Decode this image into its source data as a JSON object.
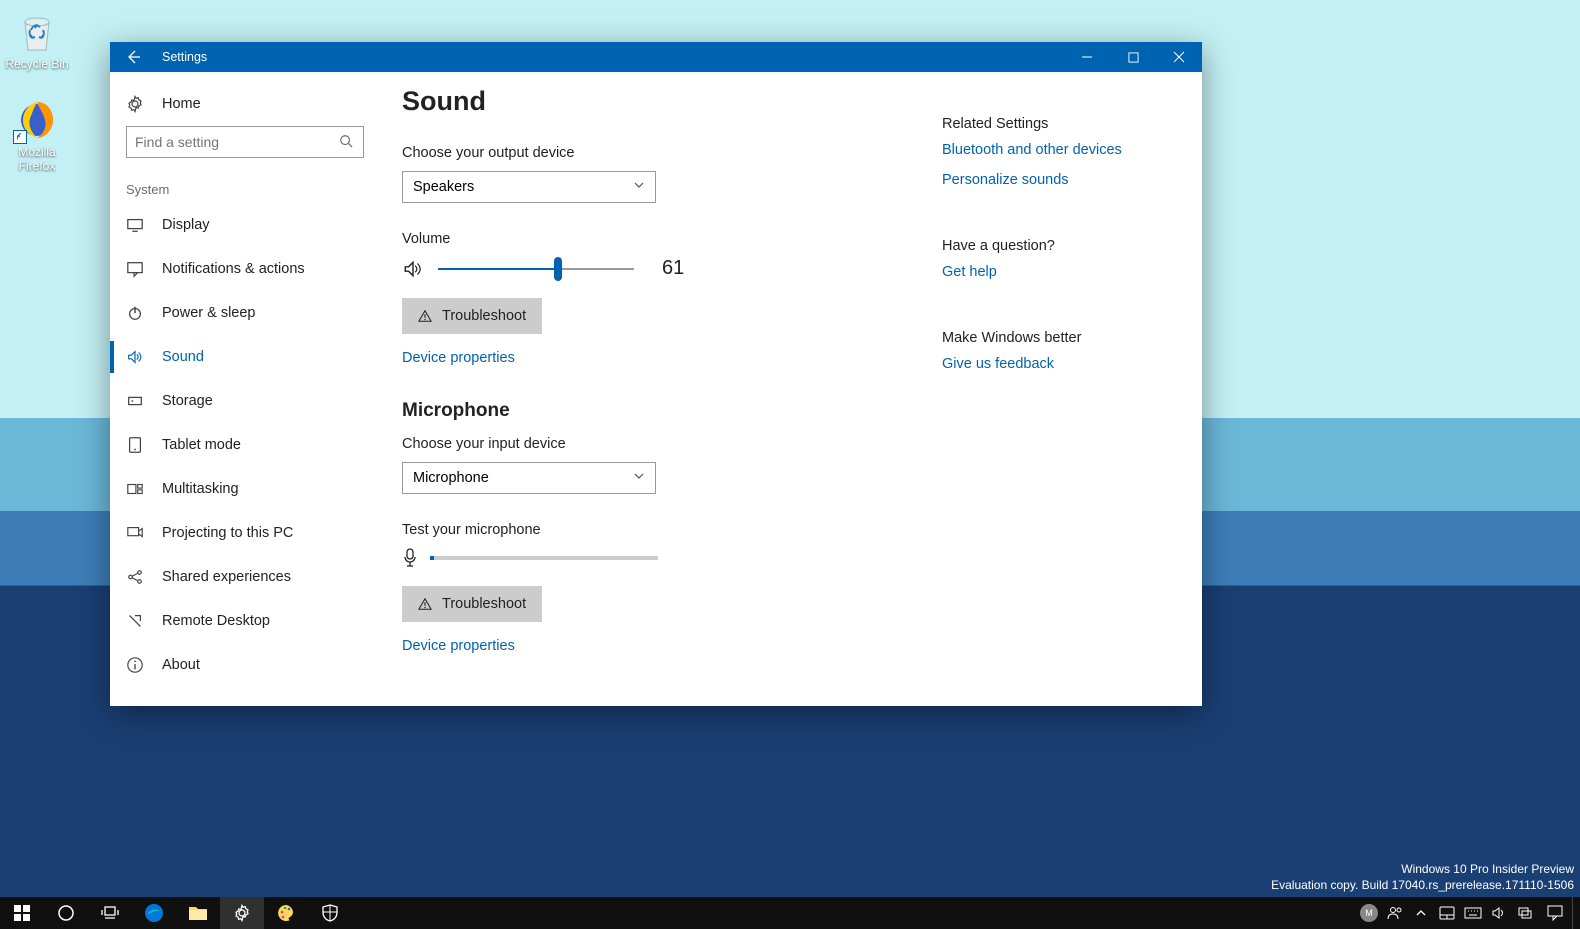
{
  "desktop": {
    "icons": [
      {
        "label": "Recycle Bin"
      },
      {
        "label": "Mozilla Firefox"
      }
    ]
  },
  "window": {
    "title": "Settings"
  },
  "sidebar": {
    "home": "Home",
    "search_placeholder": "Find a setting",
    "section": "System",
    "items": [
      {
        "label": "Display"
      },
      {
        "label": "Notifications & actions"
      },
      {
        "label": "Power & sleep"
      },
      {
        "label": "Sound"
      },
      {
        "label": "Storage"
      },
      {
        "label": "Tablet mode"
      },
      {
        "label": "Multitasking"
      },
      {
        "label": "Projecting to this PC"
      },
      {
        "label": "Shared experiences"
      },
      {
        "label": "Remote Desktop"
      },
      {
        "label": "About"
      }
    ]
  },
  "main": {
    "heading": "Sound",
    "output_label": "Choose your output device",
    "output_value": "Speakers",
    "volume_label": "Volume",
    "volume_value": "61",
    "troubleshoot": "Troubleshoot",
    "device_props": "Device properties",
    "mic_heading": "Microphone",
    "input_label": "Choose your input device",
    "input_value": "Microphone",
    "test_label": "Test your microphone"
  },
  "right": {
    "related_head": "Related Settings",
    "related_links": [
      "Bluetooth and other devices",
      "Personalize sounds"
    ],
    "question_head": "Have a question?",
    "question_link": "Get help",
    "better_head": "Make Windows better",
    "better_link": "Give us feedback"
  },
  "watermark": {
    "line1": "Windows 10 Pro Insider Preview",
    "line2": "Evaluation copy. Build 17040.rs_prerelease.171110-1506"
  },
  "taskbar": {
    "clock": "",
    "avatar": "M"
  }
}
